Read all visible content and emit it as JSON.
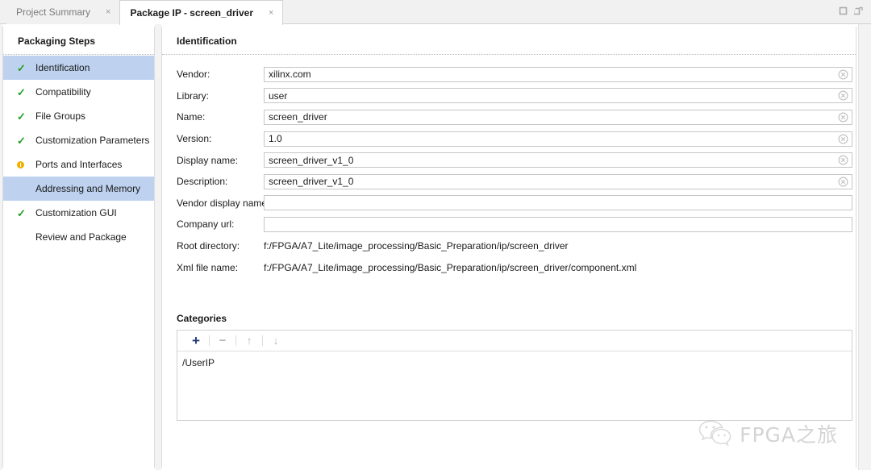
{
  "window": {
    "controls": [
      {
        "name": "maximize-icon",
        "label": "Maximize"
      },
      {
        "name": "float-icon",
        "label": "Float"
      }
    ]
  },
  "tabs": [
    {
      "label": "Project Summary",
      "active": false,
      "close": "×"
    },
    {
      "label": "Package IP - screen_driver",
      "active": true,
      "close": "×"
    }
  ],
  "sidebar": {
    "title": "Packaging Steps",
    "items": [
      {
        "label": "Identification",
        "status": "check",
        "selected": true
      },
      {
        "label": "Compatibility",
        "status": "check",
        "selected": false
      },
      {
        "label": "File Groups",
        "status": "check",
        "selected": false
      },
      {
        "label": "Customization Parameters",
        "status": "check",
        "selected": false
      },
      {
        "label": "Ports and Interfaces",
        "status": "warn",
        "selected": false
      },
      {
        "label": "Addressing and Memory",
        "status": "none",
        "selected": true
      },
      {
        "label": "Customization GUI",
        "status": "check",
        "selected": false
      },
      {
        "label": "Review and Package",
        "status": "none",
        "selected": false
      }
    ]
  },
  "main": {
    "title": "Identification",
    "fields": [
      {
        "label": "Vendor:",
        "value": "xilinx.com",
        "placeholder": "",
        "clearable": true,
        "type": "input"
      },
      {
        "label": "Library:",
        "value": "user",
        "placeholder": "",
        "clearable": true,
        "type": "input"
      },
      {
        "label": "Name:",
        "value": "screen_driver",
        "placeholder": "",
        "clearable": true,
        "type": "input"
      },
      {
        "label": "Version:",
        "value": "1.0",
        "placeholder": "",
        "clearable": true,
        "type": "input"
      },
      {
        "label": "Display name:",
        "value": "screen_driver_v1_0",
        "placeholder": "",
        "clearable": true,
        "type": "input"
      },
      {
        "label": "Description:",
        "value": "screen_driver_v1_0",
        "placeholder": "",
        "clearable": true,
        "type": "input"
      },
      {
        "label": "Vendor display name:",
        "value": "",
        "placeholder": "",
        "clearable": false,
        "type": "input"
      },
      {
        "label": "Company url:",
        "value": "",
        "placeholder": "",
        "clearable": false,
        "type": "input"
      },
      {
        "label": "Root directory:",
        "value": "f:/FPGA/A7_Lite/image_processing/Basic_Preparation/ip/screen_driver",
        "type": "static"
      },
      {
        "label": "Xml file name:",
        "value": "f:/FPGA/A7_Lite/image_processing/Basic_Preparation/ip/screen_driver/component.xml",
        "type": "static"
      }
    ],
    "categories": {
      "title": "Categories",
      "toolbar": [
        {
          "name": "add-category-button",
          "glyph": "+",
          "state": "enabled"
        },
        {
          "name": "remove-category-button",
          "glyph": "−",
          "state": "disabled"
        },
        {
          "name": "move-up-button",
          "glyph": "↑",
          "state": "disabled"
        },
        {
          "name": "move-down-button",
          "glyph": "↓",
          "state": "disabled"
        }
      ],
      "items": [
        "/UserIP"
      ]
    }
  },
  "watermark": {
    "text": "FPGA之旅",
    "icon": "wechat-icon"
  },
  "colors": {
    "selection": "#bed2f0",
    "check": "#21a121",
    "warning": "#f0b000",
    "accent": "#23397a"
  }
}
